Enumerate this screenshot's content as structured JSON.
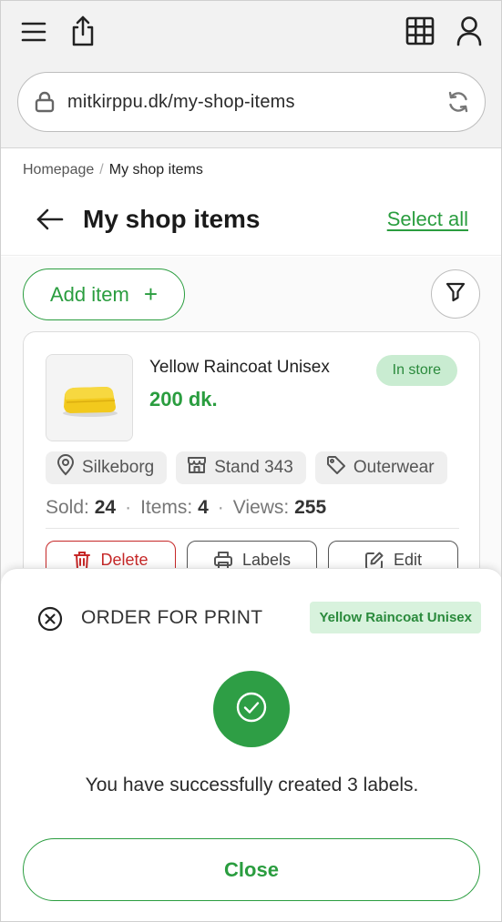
{
  "browser": {
    "url": "mitkirppu.dk/my-shop-items",
    "icons": [
      "menu-icon",
      "share-icon",
      "grid-icon",
      "user-icon",
      "lock-icon",
      "reload-icon"
    ]
  },
  "breadcrumb": {
    "home": "Homepage",
    "separator": "/",
    "current": "My shop items"
  },
  "header": {
    "title": "My shop items",
    "select_all": "Select all"
  },
  "toolbar": {
    "add_item_label": "Add item",
    "add_symbol": "+"
  },
  "item": {
    "name": "Yellow Raincoat Unisex",
    "price": "200 dk.",
    "status": "In store",
    "tags": {
      "location": "Silkeborg",
      "stand": "Stand 343",
      "category": "Outerwear"
    },
    "stats": {
      "sold_label": "Sold:",
      "sold": "24",
      "items_label": "Items:",
      "items": "4",
      "views_label": "Views:",
      "views": "255",
      "separator": "·"
    },
    "actions": {
      "delete": "Delete",
      "labels": "Labels",
      "edit": "Edit"
    }
  },
  "sheet": {
    "title": "ORDER FOR PRINT",
    "product_badge": "Yellow Raincoat Unisex",
    "message": "You have successfully created 3 labels.",
    "close_label": "Close"
  },
  "colors": {
    "accent": "#2a9d3f",
    "danger": "#c62828",
    "badge_bg": "#c9ecd1",
    "success_circle": "#2e9e45"
  }
}
